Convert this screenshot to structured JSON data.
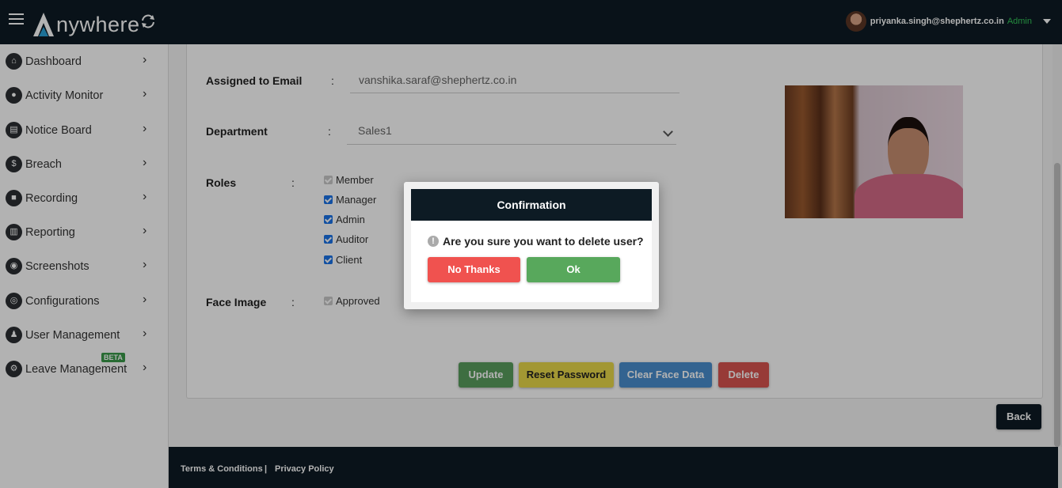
{
  "header": {
    "logo_text": "nywhere",
    "user_email": "priyanka.singh@shephertz.co.in",
    "user_role": "Admin"
  },
  "sidebar": {
    "items": [
      {
        "label": "Dashboard",
        "icon": "home-icon"
      },
      {
        "label": "Activity Monitor",
        "icon": "user-monitor-icon"
      },
      {
        "label": "Notice Board",
        "icon": "clipboard-icon"
      },
      {
        "label": "Breach",
        "icon": "money-bag-icon"
      },
      {
        "label": "Recording",
        "icon": "video-camera-icon"
      },
      {
        "label": "Reporting",
        "icon": "bar-chart-icon"
      },
      {
        "label": "Screenshots",
        "icon": "camera-icon"
      },
      {
        "label": "Configurations",
        "icon": "fingerprint-icon"
      },
      {
        "label": "User Management",
        "icon": "users-icon"
      },
      {
        "label": "Leave Management",
        "icon": "gear-icon",
        "badge": "BETA"
      }
    ]
  },
  "form": {
    "assigned_email_label": "Assigned to Email",
    "assigned_email_value": "vanshika.saraf@shephertz.co.in",
    "department_label": "Department",
    "department_value": "Sales1",
    "roles_label": "Roles",
    "roles": [
      {
        "label": "Member",
        "checked": true,
        "disabled": true
      },
      {
        "label": "Manager",
        "checked": true
      },
      {
        "label": "Admin",
        "checked": true
      },
      {
        "label": "Auditor",
        "checked": true
      },
      {
        "label": "Client",
        "checked": true
      }
    ],
    "face_image_label": "Face Image",
    "face_approved_label": "Approved",
    "colon": ":"
  },
  "actions": {
    "update": "Update",
    "reset_password": "Reset Password",
    "clear_face_data": "Clear Face Data",
    "delete": "Delete",
    "back": "Back"
  },
  "footer": {
    "terms": "Terms & Conditions",
    "separator": "|",
    "privacy": "Privacy Policy"
  },
  "modal": {
    "title": "Confirmation",
    "message": "Are you sure you want to delete user?",
    "cancel_label": "No Thanks",
    "ok_label": "Ok"
  },
  "colors": {
    "navy": "#0d1b24",
    "update": "#5a9e5e",
    "reset": "#e8d84a",
    "clear": "#4a8fcf",
    "delete": "#d9534f",
    "no_thanks": "#f0524f",
    "ok": "#58a85c",
    "role_green": "#34c759"
  }
}
